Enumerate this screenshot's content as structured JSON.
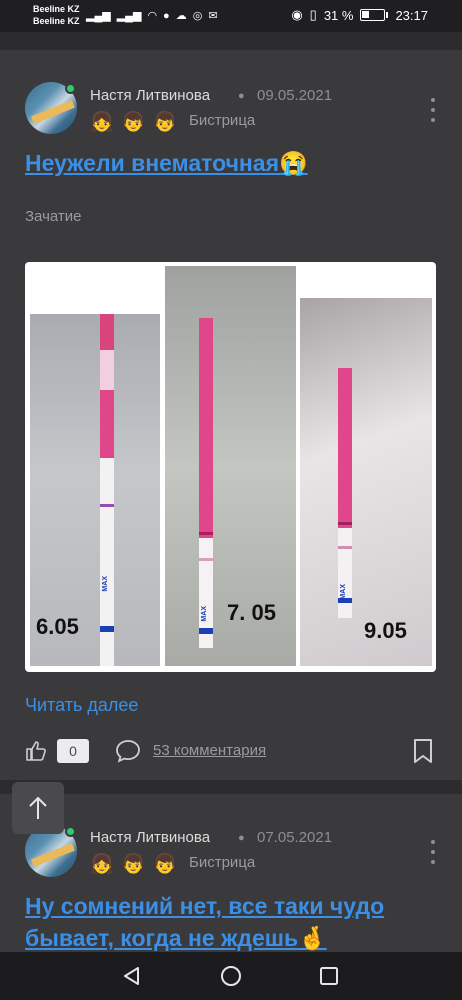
{
  "status_bar": {
    "carrier1": "Beeline KZ",
    "carrier2": "Beeline KZ",
    "battery": "31 %",
    "time": "23:17"
  },
  "posts": [
    {
      "author": "Настя Литвинова",
      "date": "09.05.2021",
      "kids": [
        "👧",
        "👦",
        "👦"
      ],
      "city": "Бистрица",
      "title": "Неужели внематочная😭",
      "category": "Зачатие",
      "photos": [
        {
          "label": "6.05"
        },
        {
          "label": "7. 05"
        },
        {
          "label": "9.05"
        }
      ],
      "strip_text": "MAX",
      "read_more": "Читать далее",
      "likes": "0",
      "comments": "53 комментария"
    },
    {
      "author": "Настя Литвинова",
      "date": "07.05.2021",
      "kids": [
        "👧",
        "👦",
        "👦"
      ],
      "city": "Бистрица",
      "title": "Ну сомнений нет, все таки чудо бывает, когда не ждешь🤞"
    }
  ],
  "icons": {
    "like": "thumbs-up-icon",
    "comment": "comment-icon",
    "bookmark": "bookmark-icon",
    "scroll_top": "arrow-up-icon",
    "menu": "kebab-menu-icon"
  },
  "colors": {
    "link": "#3b8fe6",
    "online": "#2ecc71",
    "card": "#3a3a3c"
  }
}
